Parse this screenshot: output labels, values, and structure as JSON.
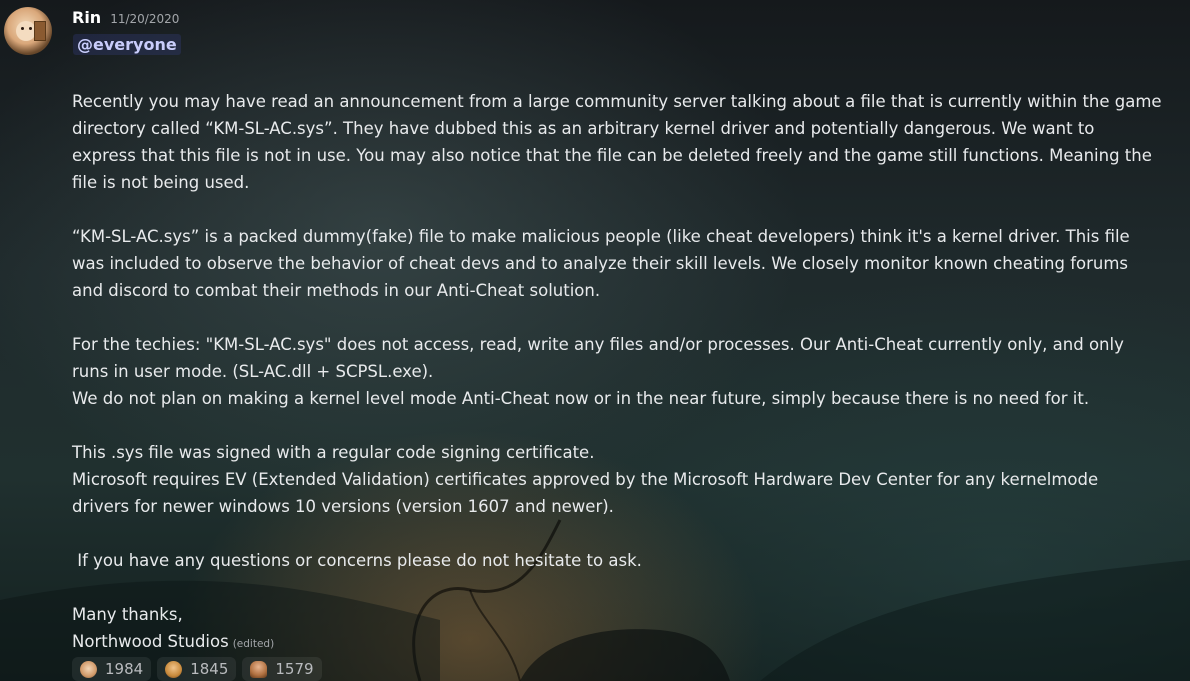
{
  "message": {
    "author": "Rin",
    "timestamp": "11/20/2020",
    "mention": "@everyone",
    "paragraphs": [
      [
        "Recently you may have read an announcement from a large community server talking about a file that is currently within the game",
        "directory called “KM-SL-AC.sys”. They have dubbed this as an arbitrary kernel driver and potentially dangerous. We want to",
        "express that this file is not in use. You may also notice that the file can be deleted freely and the game still functions. Meaning the",
        "file is not being used."
      ],
      [
        "“KM-SL-AC.sys” is a packed dummy(fake) file to make malicious people (like cheat developers) think it's a kernel driver. This file",
        "was included to observe the behavior of cheat devs and to analyze their skill levels. We closely monitor known cheating forums",
        "and discord to combat their methods in our Anti-Cheat solution."
      ],
      [
        "For the techies: \"KM-SL-AC.sys\" does not access, read, write any files and/or processes. Our Anti-Cheat currently only, and only",
        "runs in user mode. (SL-AC.dll + SCPSL.exe).",
        "We do not plan on making a kernel level mode Anti-Cheat now or in the near future, simply because there is no need for it."
      ],
      [
        "This .sys file was signed with a regular code signing certificate.",
        "Microsoft requires EV (Extended Validation) certificates approved by the Microsoft Hardware Dev Center for any kernelmode",
        "drivers for newer windows 10 versions (version 1607 and newer)."
      ],
      [
        " If you have any questions or concerns please do not hesitate to ask."
      ]
    ],
    "signoff": [
      "Many thanks,",
      "Northwood Studios"
    ],
    "edited_label": "(edited)"
  },
  "reactions": [
    {
      "emoji": "custom-face-emoji-1",
      "count": "1984"
    },
    {
      "emoji": "custom-face-emoji-2",
      "count": "1845"
    },
    {
      "emoji": "custom-figure-emoji-3",
      "count": "1579"
    }
  ]
}
